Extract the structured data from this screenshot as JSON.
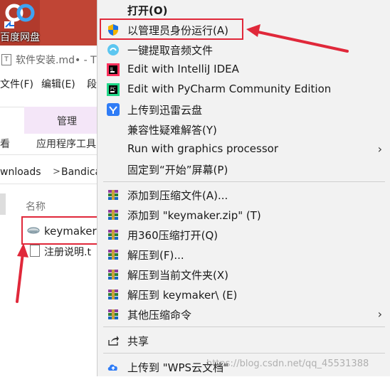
{
  "desktop": {
    "icon_label": "百度网盘"
  },
  "explorer": {
    "title": "软件安装.md• - T",
    "menus": [
      "文件(F)",
      "编辑(E)",
      "段"
    ],
    "ribbon": {
      "manage_tab": "管理",
      "view_tab": "看",
      "app_tools": "应用程序工具"
    },
    "address": {
      "crumb1": "wnloads",
      "sep": ">",
      "crumb2": "Bandica"
    },
    "files": {
      "column_name": "名称",
      "items": [
        "keymaker",
        "注册说明.t"
      ]
    }
  },
  "context_menu": {
    "items": [
      {
        "label": "打开(O)",
        "icon": "none"
      },
      {
        "label": "以管理员身份运行(A)",
        "icon": "uac-shield-icon"
      },
      {
        "label": "一键提取音频文件",
        "icon": "audio-extract-icon"
      },
      {
        "label": "Edit with IntelliJ IDEA",
        "icon": "intellij-icon"
      },
      {
        "label": "Edit with PyCharm Community Edition",
        "icon": "pycharm-icon"
      },
      {
        "label": "上传到迅雷云盘",
        "icon": "xunlei-icon"
      },
      {
        "label": "兼容性疑难解答(Y)",
        "icon": "none"
      },
      {
        "label": "Run with graphics processor",
        "icon": "none",
        "submenu": true
      },
      {
        "label": "固定到“开始”屏幕(P)",
        "icon": "none"
      },
      {
        "label": "添加到压缩文件(A)...",
        "icon": "winrar-icon"
      },
      {
        "label": "添加到 \"keymaker.zip\" (T)",
        "icon": "winrar-icon"
      },
      {
        "label": "用360压缩打开(Q)",
        "icon": "winrar-icon"
      },
      {
        "label": "解压到(F)...",
        "icon": "winrar-icon"
      },
      {
        "label": "解压到当前文件夹(X)",
        "icon": "winrar-icon"
      },
      {
        "label": "解压到 keymaker\\ (E)",
        "icon": "winrar-icon"
      },
      {
        "label": "其他压缩命令",
        "icon": "winrar-icon",
        "submenu": true
      },
      {
        "label": "共享",
        "icon": "share-icon"
      },
      {
        "label": "上传到 \"WPS云文档\"",
        "icon": "wps-cloud-icon"
      }
    ],
    "submenu_arrow": "›"
  },
  "watermark": "https://blog.csdn.net/qq_45531388",
  "colors": {
    "annotation_red": "#e0283a",
    "menu_bg": "#f2f2f2"
  }
}
